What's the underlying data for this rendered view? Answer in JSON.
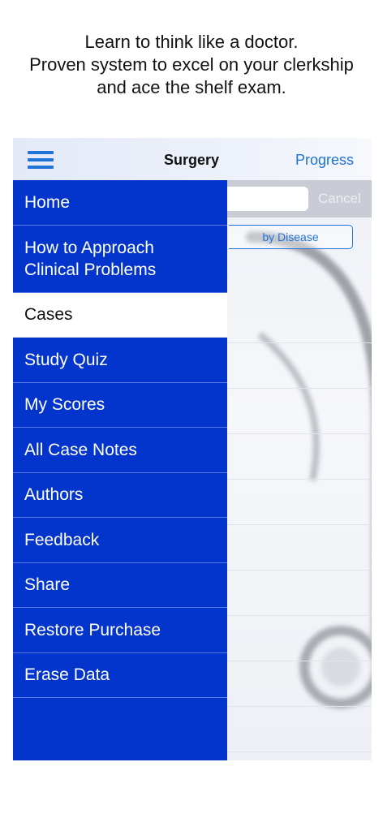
{
  "promo": {
    "line1": "Learn to think like a doctor.",
    "line2": "Proven system to excel on your clerkship",
    "line3": "and ace the shelf exam."
  },
  "header": {
    "title": "Surgery",
    "progress_label": "Progress",
    "menu_icon": "hamburger-menu-icon"
  },
  "search": {
    "value": "",
    "cancel_label": "Cancel"
  },
  "segment": {
    "selected_label": "by Disease"
  },
  "menu": {
    "items": [
      {
        "label": "Home"
      },
      {
        "label": "How to Approach\nClinical Problems"
      },
      {
        "label": "Cases",
        "selected": true
      },
      {
        "label": "Study Quiz"
      },
      {
        "label": "My Scores"
      },
      {
        "label": "All Case Notes"
      },
      {
        "label": "Authors"
      },
      {
        "label": "Feedback"
      },
      {
        "label": "Share"
      },
      {
        "label": "Restore Purchase"
      },
      {
        "label": "Erase Data"
      }
    ]
  },
  "colors": {
    "menu_background": "#0335cc",
    "accent": "#1f73d6",
    "selected_background": "#ffffff"
  }
}
